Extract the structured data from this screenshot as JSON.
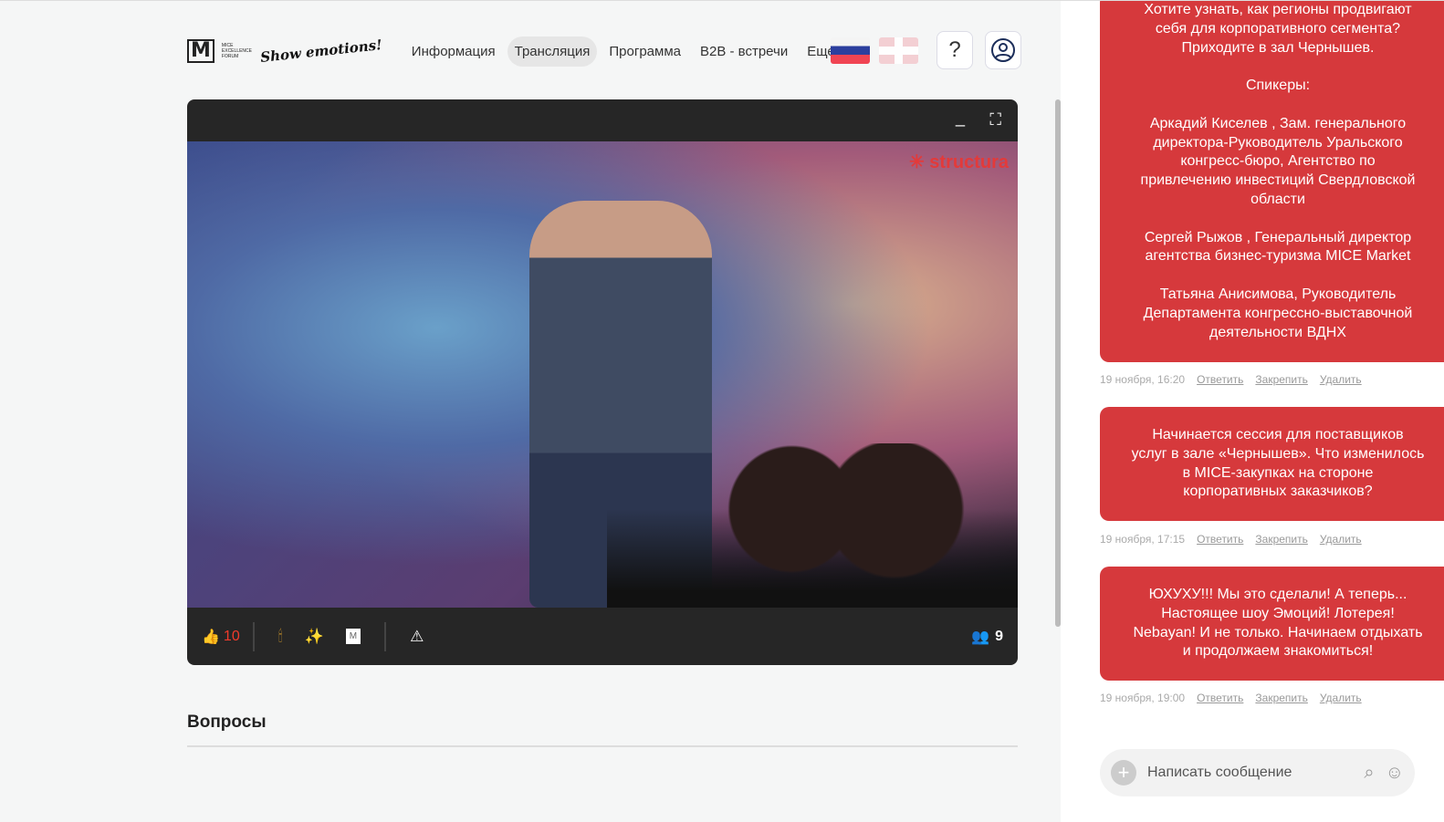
{
  "nav": {
    "logo_small": "MICE EXCELLENCE FORUM",
    "logo_script": "Show emotions!",
    "items": [
      "Информация",
      "Трансляция",
      "Программа",
      "B2B - встречи",
      "Еще"
    ],
    "active": 1,
    "help": "?"
  },
  "player": {
    "brand": "structura",
    "likes": "10",
    "viewers": "9"
  },
  "questions": {
    "title": "Вопросы"
  },
  "chat": {
    "messages": [
      {
        "text": "Хотите узнать, как регионы продвигают\nсебя для корпоративного сегмента?\nПриходите в зал Чернышев.\n\nСпикеры:\n\nАркадий Киселев , Зам. генерального\nдиректора-Руководитель Уральского\nконгресс-бюро, Агентство по\nпривлечению инвестиций Свердловской\nобласти\n\nСергей Рыжов , Генеральный директор\nагентства бизнес-туризма MICE Market\n\nТатьяна Анисимова, Руководитель\nДепартамента конгрессно-выставочной\nдеятельности ВДНХ",
        "time": "19 ноября, 16:20"
      },
      {
        "text": "Начинается сессия для поставщиков\nуслуг в зале «Чернышев». Что изменилось\nв  MICE-закупках на стороне\nкорпоративных заказчиков?",
        "time": "19 ноября, 17:15"
      },
      {
        "text": "ЮХУХУ!!! Мы это сделали! А теперь...\nНастоящее шоу Эмоций! Лотерея!\nNebayan! И не только. Начинаем отдыхать\nи продолжаем знакомиться!",
        "time": "19 ноября, 19:00"
      }
    ],
    "reply": "Ответить",
    "pin": "Закрепить",
    "delete": "Удалить",
    "placeholder": "Написать сообщение"
  }
}
